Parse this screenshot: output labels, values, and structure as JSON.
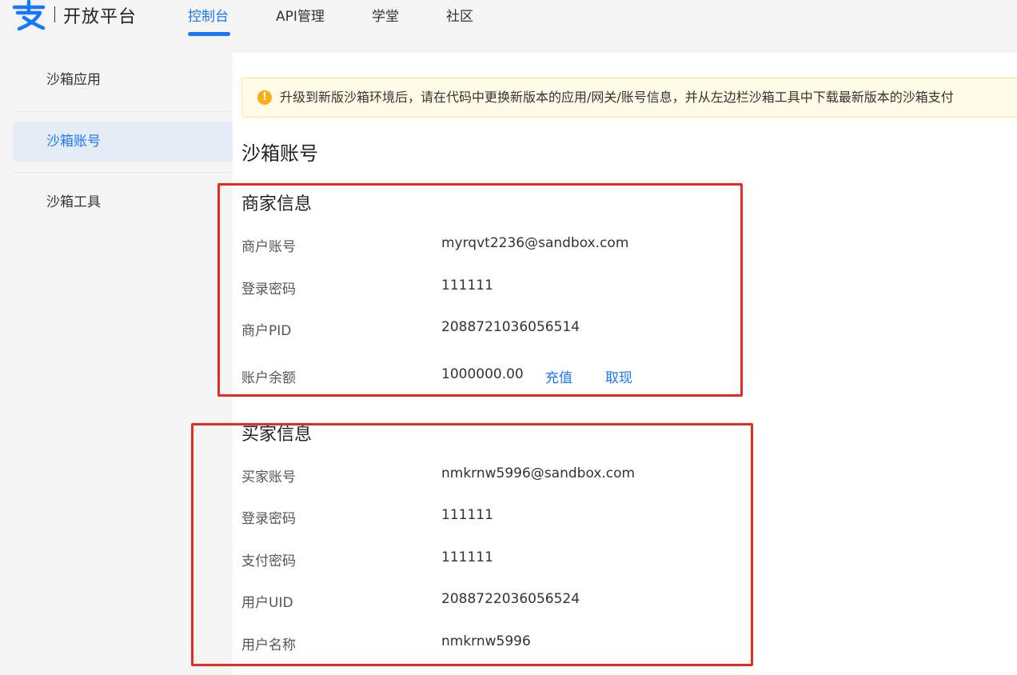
{
  "header": {
    "logo_text": "开放平台",
    "nav": [
      {
        "label": "控制台",
        "active": true
      },
      {
        "label": "API管理",
        "active": false
      },
      {
        "label": "学堂",
        "active": false
      },
      {
        "label": "社区",
        "active": false
      }
    ]
  },
  "sidebar": {
    "items": [
      {
        "label": "沙箱应用",
        "active": false
      },
      {
        "label": "沙箱账号",
        "active": true
      },
      {
        "label": "沙箱工具",
        "active": false
      }
    ]
  },
  "alert": {
    "icon": "warning-icon",
    "text": "升级到新版沙箱环境后，请在代码中更换新版本的应用/网关/账号信息，并从左边栏沙箱工具中下载最新版本的沙箱支付"
  },
  "main": {
    "title": "沙箱账号",
    "merchant": {
      "title": "商家信息",
      "rows": [
        {
          "label": "商户账号",
          "value": "myrqvt2236@sandbox.com"
        },
        {
          "label": "登录密码",
          "value": "111111"
        },
        {
          "label": "商户PID",
          "value": "2088721036056514"
        },
        {
          "label": "账户余额",
          "value": "1000000.00"
        }
      ],
      "actions": {
        "recharge": "充值",
        "withdraw": "取现"
      }
    },
    "buyer": {
      "title": "买家信息",
      "rows": [
        {
          "label": "买家账号",
          "value": "nmkrnw5996@sandbox.com"
        },
        {
          "label": "登录密码",
          "value": "111111"
        },
        {
          "label": "支付密码",
          "value": "111111"
        },
        {
          "label": "用户UID",
          "value": "2088722036056524"
        },
        {
          "label": "用户名称",
          "value": "nmkrnw5996"
        }
      ]
    }
  },
  "colors": {
    "accent": "#1677ff",
    "highlight_box": "#e52b22",
    "alert_bg": "#fffbe6",
    "alert_icon": "#faad14"
  }
}
